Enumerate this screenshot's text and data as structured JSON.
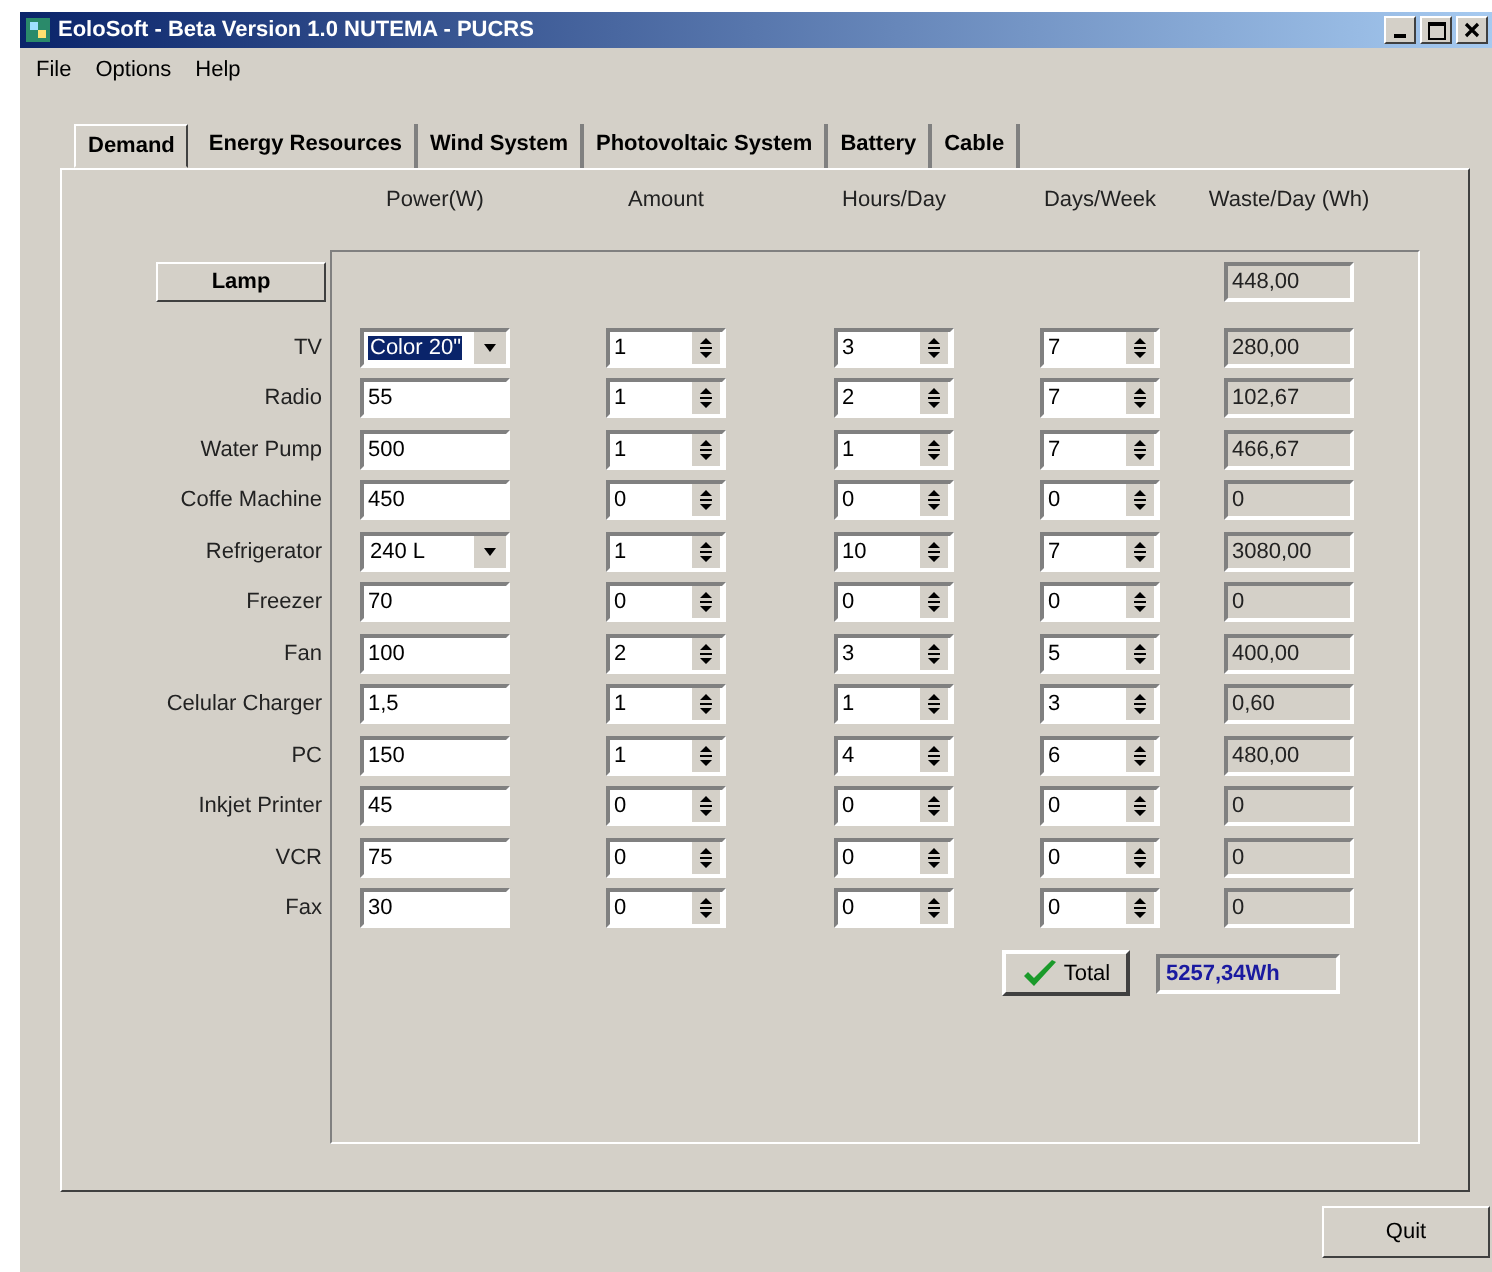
{
  "window": {
    "title": "EoloSoft - Beta Version 1.0 NUTEMA - PUCRS"
  },
  "menu": [
    "File",
    "Options",
    "Help"
  ],
  "tabs": [
    {
      "label": "Demand",
      "selected": true
    },
    {
      "label": "Energy Resources",
      "selected": false
    },
    {
      "label": "Wind System",
      "selected": false
    },
    {
      "label": "Photovoltaic System",
      "selected": false
    },
    {
      "label": "Battery",
      "selected": false
    },
    {
      "label": "Cable",
      "selected": false
    }
  ],
  "columns": [
    "Power(W)",
    "Amount",
    "Hours/Day",
    "Days/Week",
    "Waste/Day (Wh)"
  ],
  "rows": [
    {
      "kind": "button",
      "label": "Lamp",
      "wh": "448,00"
    },
    {
      "kind": "item",
      "label": "TV",
      "power": {
        "kind": "combo",
        "value": "Color 20\"",
        "highlighted": true
      },
      "amount": "1",
      "hours": "3",
      "days": "7",
      "wh": "280,00"
    },
    {
      "kind": "item",
      "label": "Radio",
      "power": {
        "kind": "input",
        "value": "55"
      },
      "amount": "1",
      "hours": "2",
      "days": "7",
      "wh": "102,67"
    },
    {
      "kind": "item",
      "label": "Water Pump",
      "power": {
        "kind": "input",
        "value": "500"
      },
      "amount": "1",
      "hours": "1",
      "days": "7",
      "wh": "466,67"
    },
    {
      "kind": "item",
      "label": "Coffe Machine",
      "power": {
        "kind": "input",
        "value": "450"
      },
      "amount": "0",
      "hours": "0",
      "days": "0",
      "wh": "0"
    },
    {
      "kind": "item",
      "label": "Refrigerator",
      "power": {
        "kind": "combo",
        "value": "240 L",
        "highlighted": false
      },
      "amount": "1",
      "hours": "10",
      "days": "7",
      "wh": "3080,00"
    },
    {
      "kind": "item",
      "label": "Freezer",
      "power": {
        "kind": "input",
        "value": "70"
      },
      "amount": "0",
      "hours": "0",
      "days": "0",
      "wh": "0"
    },
    {
      "kind": "item",
      "label": "Fan",
      "power": {
        "kind": "input",
        "value": "100"
      },
      "amount": "2",
      "hours": "3",
      "days": "5",
      "wh": "400,00"
    },
    {
      "kind": "item",
      "label": "Celular Charger",
      "power": {
        "kind": "input",
        "value": "1,5"
      },
      "amount": "1",
      "hours": "1",
      "days": "3",
      "wh": "0,60"
    },
    {
      "kind": "item",
      "label": "PC",
      "power": {
        "kind": "input",
        "value": "150"
      },
      "amount": "1",
      "hours": "4",
      "days": "6",
      "wh": "480,00"
    },
    {
      "kind": "item",
      "label": "Inkjet Printer",
      "power": {
        "kind": "input",
        "value": "45"
      },
      "amount": "0",
      "hours": "0",
      "days": "0",
      "wh": "0"
    },
    {
      "kind": "item",
      "label": "VCR",
      "power": {
        "kind": "input",
        "value": "75"
      },
      "amount": "0",
      "hours": "0",
      "days": "0",
      "wh": "0"
    },
    {
      "kind": "item",
      "label": "Fax",
      "power": {
        "kind": "input",
        "value": "30"
      },
      "amount": "0",
      "hours": "0",
      "days": "0",
      "wh": "0"
    }
  ],
  "total": {
    "button": "Total",
    "value": "5257,34Wh"
  },
  "quit_button": "Quit"
}
